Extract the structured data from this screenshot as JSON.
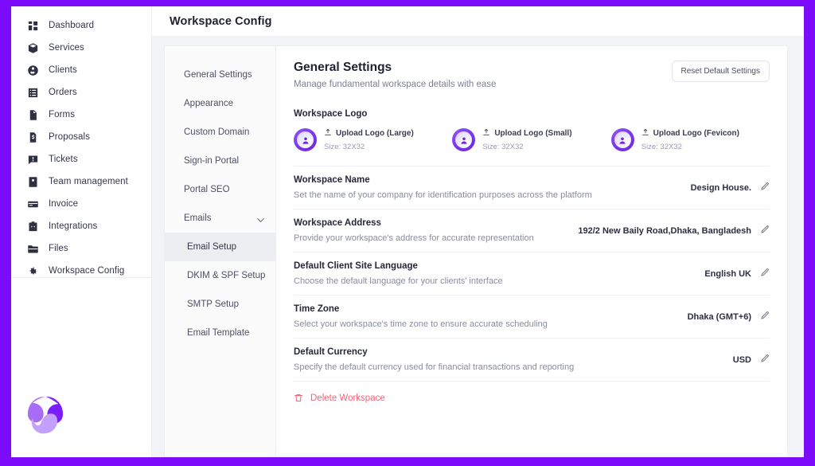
{
  "window": {
    "accent_color": "#7B0BFA",
    "surface_color": "#ffffff",
    "canvas_color": "#f2f3f7"
  },
  "topbar": {
    "title": "Workspace Config"
  },
  "sidebar": {
    "items": [
      {
        "label": "Dashboard",
        "icon": "grid-icon"
      },
      {
        "label": "Services",
        "icon": "box-icon"
      },
      {
        "label": "Clients",
        "icon": "users-circle-icon"
      },
      {
        "label": "Orders",
        "icon": "list-box-icon"
      },
      {
        "label": "Forms",
        "icon": "document-icon"
      },
      {
        "label": "Proposals",
        "icon": "proposal-icon"
      },
      {
        "label": "Tickets",
        "icon": "ticket-chat-icon"
      },
      {
        "label": "Team management",
        "icon": "person-card-icon"
      },
      {
        "label": "Invoice",
        "icon": "card-icon"
      },
      {
        "label": "Integrations",
        "icon": "plug-box-icon"
      },
      {
        "label": "Files",
        "icon": "folder-icon"
      },
      {
        "label": "Workspace Config",
        "icon": "gear-icon"
      }
    ]
  },
  "subnav": {
    "items": [
      {
        "label": "General Settings",
        "type": "item",
        "active": false
      },
      {
        "label": "Appearance",
        "type": "item",
        "active": false
      },
      {
        "label": "Custom Domain",
        "type": "item",
        "active": false
      },
      {
        "label": "Sign-in Portal",
        "type": "item",
        "active": false
      },
      {
        "label": "Portal SEO",
        "type": "item",
        "active": false
      },
      {
        "label": "Emails",
        "type": "group",
        "active": false,
        "expanded": true
      },
      {
        "label": "Email Setup",
        "type": "child",
        "active": true
      },
      {
        "label": "DKIM & SPF Setup",
        "type": "child",
        "active": false
      },
      {
        "label": "SMTP Setup",
        "type": "child",
        "active": false
      },
      {
        "label": "Email Template",
        "type": "child",
        "active": false
      }
    ]
  },
  "panel": {
    "title": "General Settings",
    "subtitle": "Manage fundamental workspace details with ease",
    "reset_label": "Reset Default Settings",
    "logo_section_label": "Workspace Logo",
    "logos": [
      {
        "upload_label": "Upload Logo (Large)",
        "size_label": "Size: 32X32"
      },
      {
        "upload_label": "Upload Logo (Small)",
        "size_label": "Size: 32X32"
      },
      {
        "upload_label": "Upload Logo (Fevicon)",
        "size_label": "Size: 32X32"
      }
    ],
    "settings": [
      {
        "title": "Workspace Name",
        "description": "Set the name of your company for identification purposes across the platform",
        "value": "Design House."
      },
      {
        "title": "Workspace Address",
        "description": "Provide your workspace's address for accurate representation",
        "value": "192/2 New Baily Road,Dhaka, Bangladesh"
      },
      {
        "title": "Default Client Site Language",
        "description": "Choose the default language for your clients' interface",
        "value": "English UK"
      },
      {
        "title": "Time Zone",
        "description": "Select your workspace's time zone to ensure accurate scheduling",
        "value": "Dhaka (GMT+6)"
      },
      {
        "title": "Default Currency",
        "description": "Specify the default currency used for financial transactions and reporting",
        "value": "USD"
      }
    ],
    "delete_label": "Delete Workspace",
    "delete_color": "#f2647a"
  }
}
